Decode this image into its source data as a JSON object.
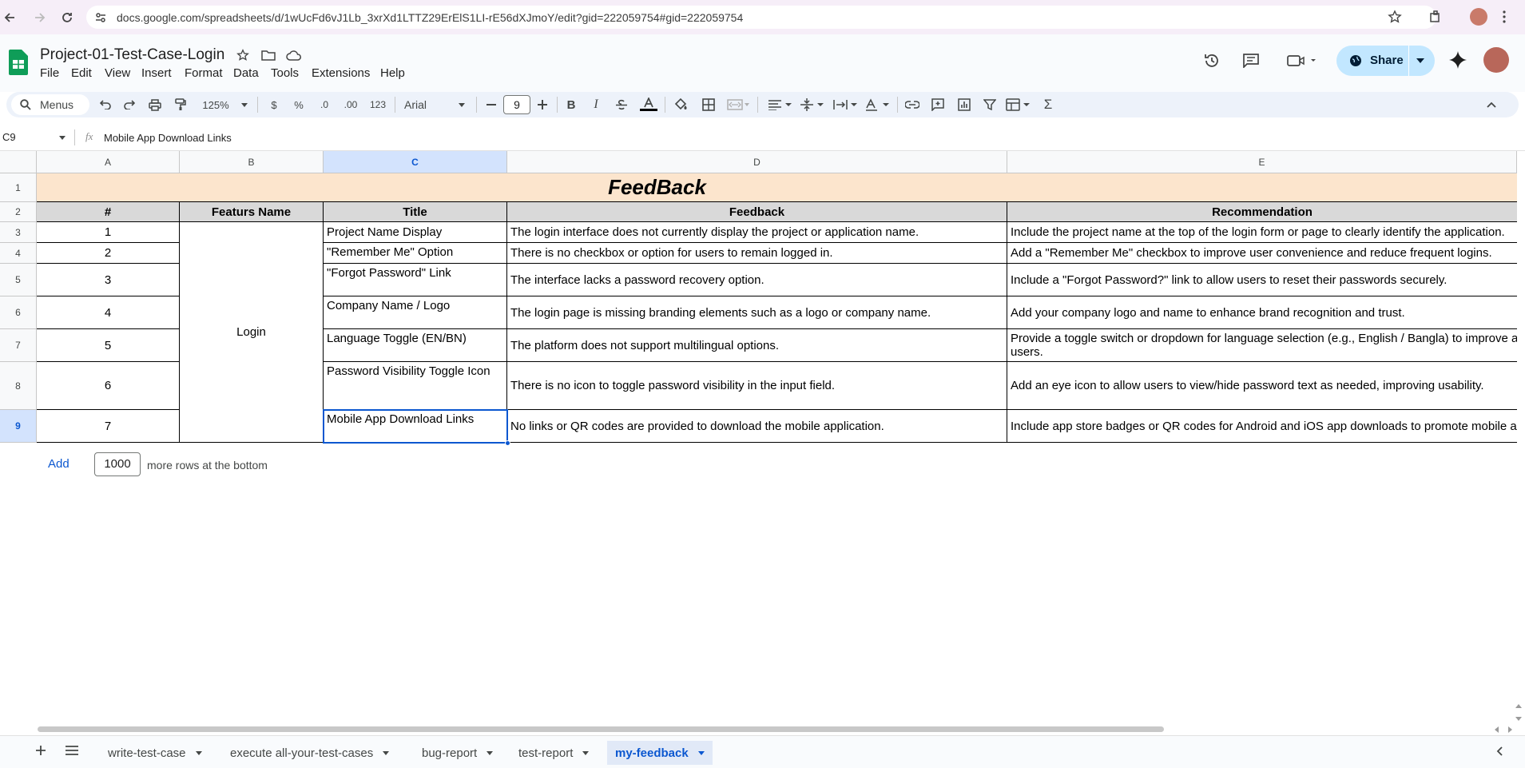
{
  "browser": {
    "url": "docs.google.com/spreadsheets/d/1wUcFd6vJ1Lb_3xrXd1LTTZ29ErElS1LI-rE56dXJmoY/edit?gid=222059754#gid=222059754"
  },
  "app": {
    "title": "Project-01-Test-Case-Login",
    "menu": [
      "File",
      "Edit",
      "View",
      "Insert",
      "Format",
      "Data",
      "Tools",
      "Extensions",
      "Help"
    ],
    "share_label": "Share",
    "accent": "#0b57d0",
    "sheets_green": "#0f9d58"
  },
  "toolbar": {
    "menus_label": "Menus",
    "zoom": "125%",
    "currency": "$",
    "percent": "%",
    "dec_dec": ".0",
    "inc_dec": ".00",
    "number_format": "123",
    "font": "Arial",
    "font_size": "9"
  },
  "formula_bar": {
    "name_box": "C9",
    "fx": "fx",
    "content": "Mobile App Download Links"
  },
  "grid": {
    "columns": [
      "A",
      "B",
      "C",
      "D",
      "E"
    ],
    "rows": [
      "1",
      "2",
      "3",
      "4",
      "5",
      "6",
      "7",
      "8",
      "9"
    ],
    "banner": "FeedBack",
    "banner_color": "#fce5cd",
    "headers": [
      "#",
      "Featurs Name",
      "Title",
      "Feedback",
      "Recommendation"
    ],
    "feature": "Login",
    "data": [
      {
        "num": "1",
        "title": "Project Name Display",
        "feedback": "The login interface does not currently display the project or application name.",
        "rec": "Include the project name at the top of the login form or page to clearly identify the application."
      },
      {
        "num": "2",
        "title": "\"Remember Me\" Option",
        "feedback": "There is no checkbox or option for users to remain logged in.",
        "rec": "Add a \"Remember Me\" checkbox to improve user convenience and reduce frequent logins."
      },
      {
        "num": "3",
        "title": "\"Forgot Password\" Link",
        "feedback": "The interface lacks a password recovery option.",
        "rec": "Include a \"Forgot Password?\" link to allow users to reset their passwords securely."
      },
      {
        "num": "4",
        "title": "Company Name / Logo",
        "feedback": "The login page is missing branding elements such as a logo or company name.",
        "rec": "Add your company logo and name to enhance brand recognition and trust."
      },
      {
        "num": "5",
        "title": "Language Toggle (EN/BN)",
        "feedback": "The platform does not support multilingual options.",
        "rec": "Provide a toggle switch or dropdown for language selection (e.g., English / Bangla) to improve a",
        "rec2": "users."
      },
      {
        "num": "6",
        "title": "Password Visibility Toggle Icon",
        "feedback": "There is no icon to toggle password visibility in the input field.",
        "rec": "Add an eye icon to allow users to view/hide password text as needed, improving usability."
      },
      {
        "num": "7",
        "title": "Mobile App Download Links",
        "feedback": "No links or QR codes are provided to download the mobile application.",
        "rec": "Include app store badges or QR codes for Android and iOS app downloads to promote mobile a"
      }
    ]
  },
  "add_rows": {
    "add_label": "Add",
    "count": "1000",
    "suffix": "more rows at the bottom"
  },
  "sheet_tabs": [
    "write-test-case",
    "execute all-your-test-cases",
    "bug-report",
    "test-report",
    "my-feedback"
  ],
  "active_tab": "my-feedback"
}
